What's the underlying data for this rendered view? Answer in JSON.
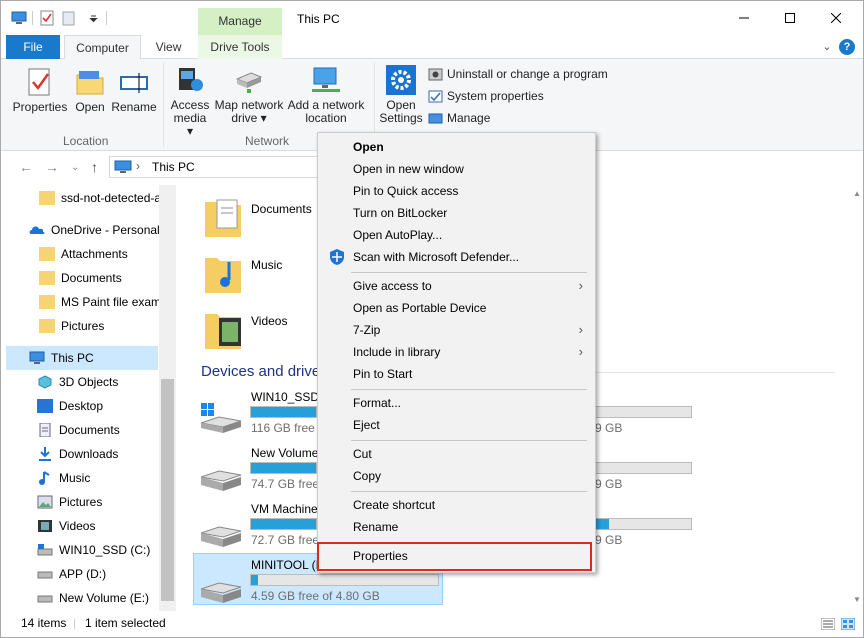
{
  "window": {
    "title": "This PC",
    "context_tab_group": "Manage"
  },
  "tabs": [
    {
      "label": "File"
    },
    {
      "label": "Computer"
    },
    {
      "label": "View"
    },
    {
      "label": "Drive Tools"
    }
  ],
  "ribbon": {
    "location": {
      "label": "Location",
      "buttons": [
        "Properties",
        "Open",
        "Rename"
      ]
    },
    "network": {
      "label": "Network",
      "access_media": [
        "Access",
        "media ▾"
      ],
      "map_drive": [
        "Map network",
        "drive ▾"
      ],
      "add_location": [
        "Add a network",
        "location"
      ]
    },
    "system": {
      "open_settings": [
        "Open",
        "Settings"
      ],
      "links": [
        "Uninstall or change a program",
        "System properties",
        "Manage"
      ]
    }
  },
  "address": {
    "path": "This PC"
  },
  "nav": {
    "items": [
      {
        "label": "ssd-not-detected-a",
        "icon": "folder-icon"
      },
      {
        "label": "OneDrive - Personal",
        "icon": "onedrive-icon"
      },
      {
        "label": "Attachments",
        "icon": "folder-icon"
      },
      {
        "label": "Documents",
        "icon": "folder-icon"
      },
      {
        "label": "MS Paint file examp",
        "icon": "folder-icon"
      },
      {
        "label": "Pictures",
        "icon": "folder-icon"
      },
      {
        "label": "This PC",
        "icon": "computer-icon"
      },
      {
        "label": "3D Objects",
        "icon": "3d-objects-icon"
      },
      {
        "label": "Desktop",
        "icon": "desktop-icon"
      },
      {
        "label": "Documents",
        "icon": "documents-icon"
      },
      {
        "label": "Downloads",
        "icon": "downloads-icon"
      },
      {
        "label": "Music",
        "icon": "music-icon"
      },
      {
        "label": "Pictures",
        "icon": "pictures-icon"
      },
      {
        "label": "Videos",
        "icon": "videos-icon"
      },
      {
        "label": "WIN10_SSD (C:)",
        "icon": "drive-icon"
      },
      {
        "label": "APP (D:)",
        "icon": "drive-icon"
      },
      {
        "label": "New Volume (E:)",
        "icon": "drive-icon"
      }
    ]
  },
  "content": {
    "folders": [
      "Documents",
      "Music",
      "Videos"
    ],
    "section": "Devices and drive",
    "drives": [
      {
        "name": "WIN10_SSD (",
        "free": "116 GB free o",
        "free_right": "9 GB",
        "fill_pct": 30
      },
      {
        "name": "New Volume",
        "free": "74.7 GB free c",
        "free_right": "9 GB",
        "fill_pct": 25
      },
      {
        "name": "VM Machine",
        "free": "72.7 GB free c",
        "free_right": "9 GB",
        "fill_pct": 75
      },
      {
        "name": "MINITOOL (I",
        "free": "4.59 GB free of 4.80 GB",
        "free_right": "",
        "fill_pct": 4
      }
    ]
  },
  "status": {
    "items": "14 items",
    "selected": "1 item selected"
  },
  "context_menu": {
    "items": [
      {
        "label": "Open"
      },
      {
        "label": "Open in new window"
      },
      {
        "label": "Pin to Quick access"
      },
      {
        "label": "Turn on BitLocker"
      },
      {
        "label": "Open AutoPlay..."
      },
      {
        "label": "Scan with Microsoft Defender..."
      },
      {
        "label": "Give access to"
      },
      {
        "label": "Open as Portable Device"
      },
      {
        "label": "7-Zip"
      },
      {
        "label": "Include in library"
      },
      {
        "label": "Pin to Start"
      },
      {
        "label": "Format..."
      },
      {
        "label": "Eject"
      },
      {
        "label": "Cut"
      },
      {
        "label": "Copy"
      },
      {
        "label": "Create shortcut"
      },
      {
        "label": "Rename"
      },
      {
        "label": "Properties"
      }
    ]
  },
  "colors": {
    "accent": "#1979ca",
    "highlight": "#cce8ff",
    "callout": "#e0281f",
    "manage_tab": "#d5f0c5"
  }
}
